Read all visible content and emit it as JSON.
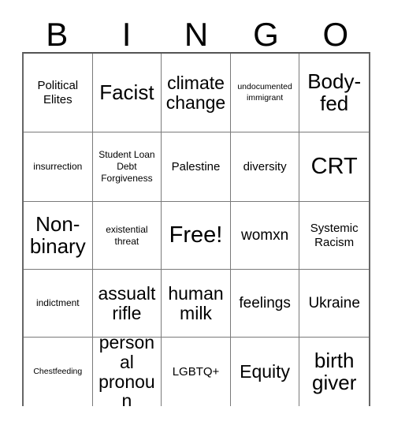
{
  "card": {
    "title": "BINGO",
    "header_letters": [
      "B",
      "I",
      "N",
      "G",
      "O"
    ],
    "grid_size": "5x5",
    "free_space_label": "Free!",
    "colors": {
      "background": "#ffffff",
      "text": "#000000",
      "grid_line": "#7a7a7a",
      "outer_border": "#666666"
    },
    "rows": [
      [
        {
          "text": "Political Elites",
          "size": "md"
        },
        {
          "text": "Facist",
          "size": "2xl"
        },
        {
          "text": "climate change",
          "size": "xl"
        },
        {
          "text": "undocumented immigrant",
          "size": "xs"
        },
        {
          "text": "Body-fed",
          "size": "2xl"
        }
      ],
      [
        {
          "text": "insurrection",
          "size": "sm"
        },
        {
          "text": "Student Loan Debt Forgiveness",
          "size": "sm"
        },
        {
          "text": "Palestine",
          "size": "md"
        },
        {
          "text": "diversity",
          "size": "md"
        },
        {
          "text": "CRT",
          "size": "3xl"
        }
      ],
      [
        {
          "text": "Non-binary",
          "size": "2xl"
        },
        {
          "text": "existential threat",
          "size": "sm"
        },
        {
          "text": "Free!",
          "size": "3xl"
        },
        {
          "text": "womxn",
          "size": "lg"
        },
        {
          "text": "Systemic Racism",
          "size": "md"
        }
      ],
      [
        {
          "text": "indictment",
          "size": "sm"
        },
        {
          "text": "assualt rifle",
          "size": "xl"
        },
        {
          "text": "human milk",
          "size": "xl"
        },
        {
          "text": "feelings",
          "size": "lg"
        },
        {
          "text": "Ukraine",
          "size": "lg"
        }
      ],
      [
        {
          "text": "Chestfeeding",
          "size": "xs"
        },
        {
          "text": "personal pronoun",
          "size": "xl"
        },
        {
          "text": "LGBTQ+",
          "size": "md"
        },
        {
          "text": "Equity",
          "size": "xl"
        },
        {
          "text": "birth giver",
          "size": "2xl"
        }
      ]
    ]
  }
}
